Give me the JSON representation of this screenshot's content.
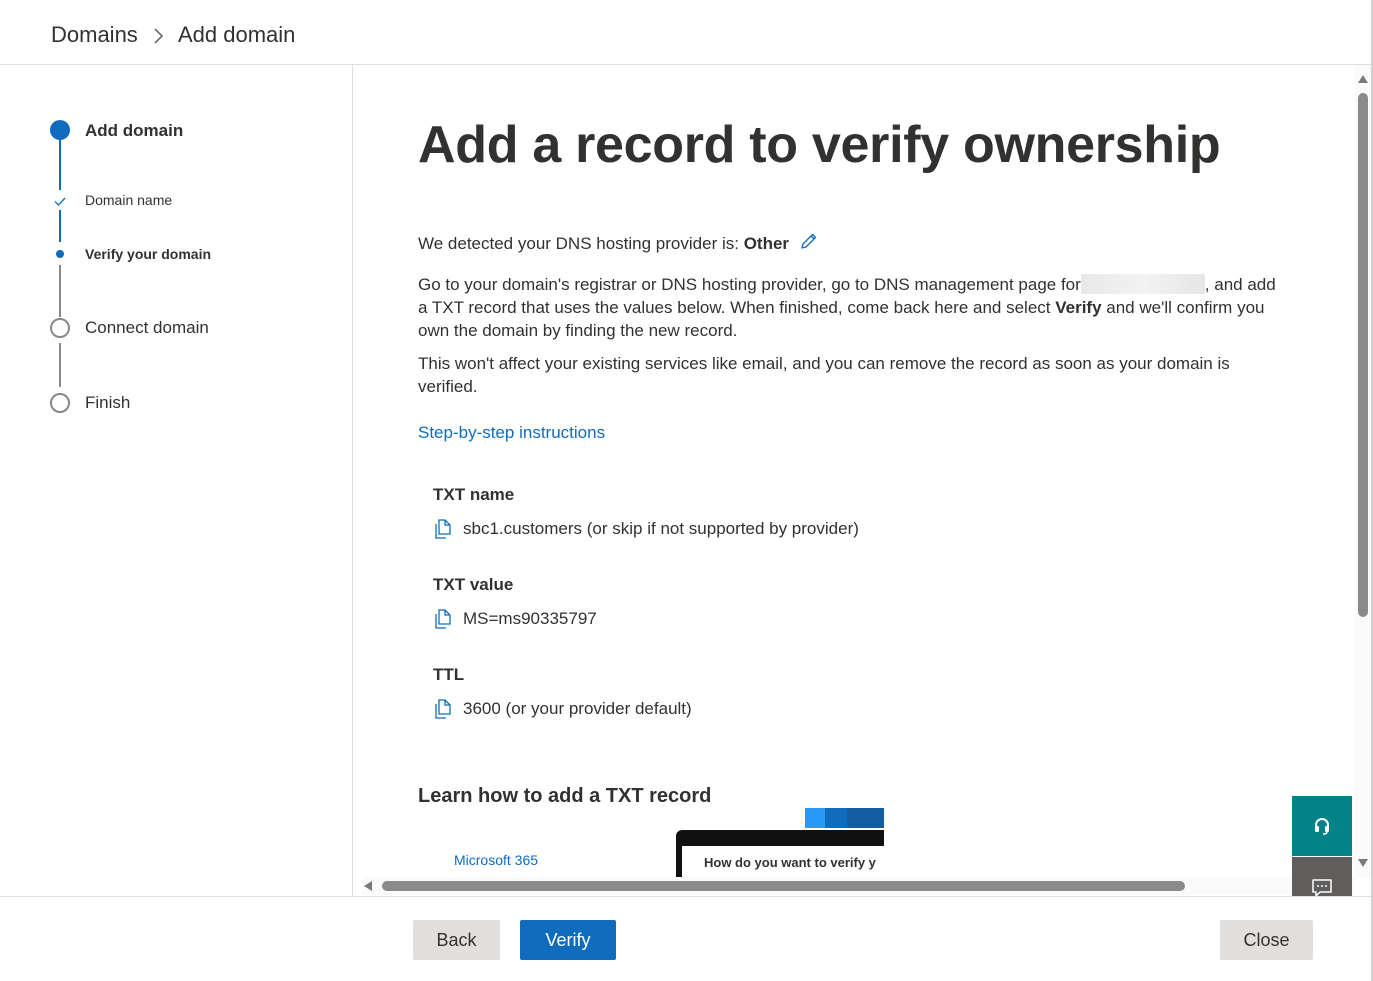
{
  "breadcrumb": {
    "root": "Domains",
    "current": "Add domain"
  },
  "stepper": {
    "steps": [
      {
        "label": "Add domain",
        "state": "active"
      },
      {
        "label": "Domain name",
        "state": "completed"
      },
      {
        "label": "Verify your domain",
        "state": "current"
      },
      {
        "label": "Connect domain",
        "state": "pending"
      },
      {
        "label": "Finish",
        "state": "pending"
      }
    ]
  },
  "main": {
    "title": "Add a record to verify ownership",
    "detected_prefix": "We detected your DNS hosting provider is: ",
    "detected_provider": "Other",
    "instructions_part1": "Go to your domain's registrar or DNS hosting provider, go to DNS management page for",
    "instructions_part2": ", and add a TXT record that uses the values below. When finished, come back here and select ",
    "instructions_bold": "Verify",
    "instructions_part3": " and we'll confirm you own the domain by finding the new record.",
    "note": "This won't affect your existing services like email, and you can remove the record as soon as your domain is verified.",
    "link": "Step-by-step instructions",
    "fields": [
      {
        "label": "TXT name",
        "value": "sbc1.customers (or skip if not supported by provider)"
      },
      {
        "label": "TXT value",
        "value": "MS=ms90335797"
      },
      {
        "label": "TTL",
        "value": "3600 (or your provider default)"
      }
    ],
    "learn_title": "Learn how to add a TXT record",
    "video_brand": "Microsoft 365",
    "video_caption": "How do you want to verify y"
  },
  "footer": {
    "back": "Back",
    "verify": "Verify",
    "close": "Close"
  },
  "colors": {
    "accent": "#0f6cbd",
    "help_button": "#038387",
    "feedback_button": "#605e5c"
  },
  "icons": {
    "breadcrumb_separator": "chevron-right-icon",
    "edit": "pencil-icon",
    "copy": "copy-icon",
    "help": "headset-icon",
    "feedback": "feedback-icon"
  }
}
